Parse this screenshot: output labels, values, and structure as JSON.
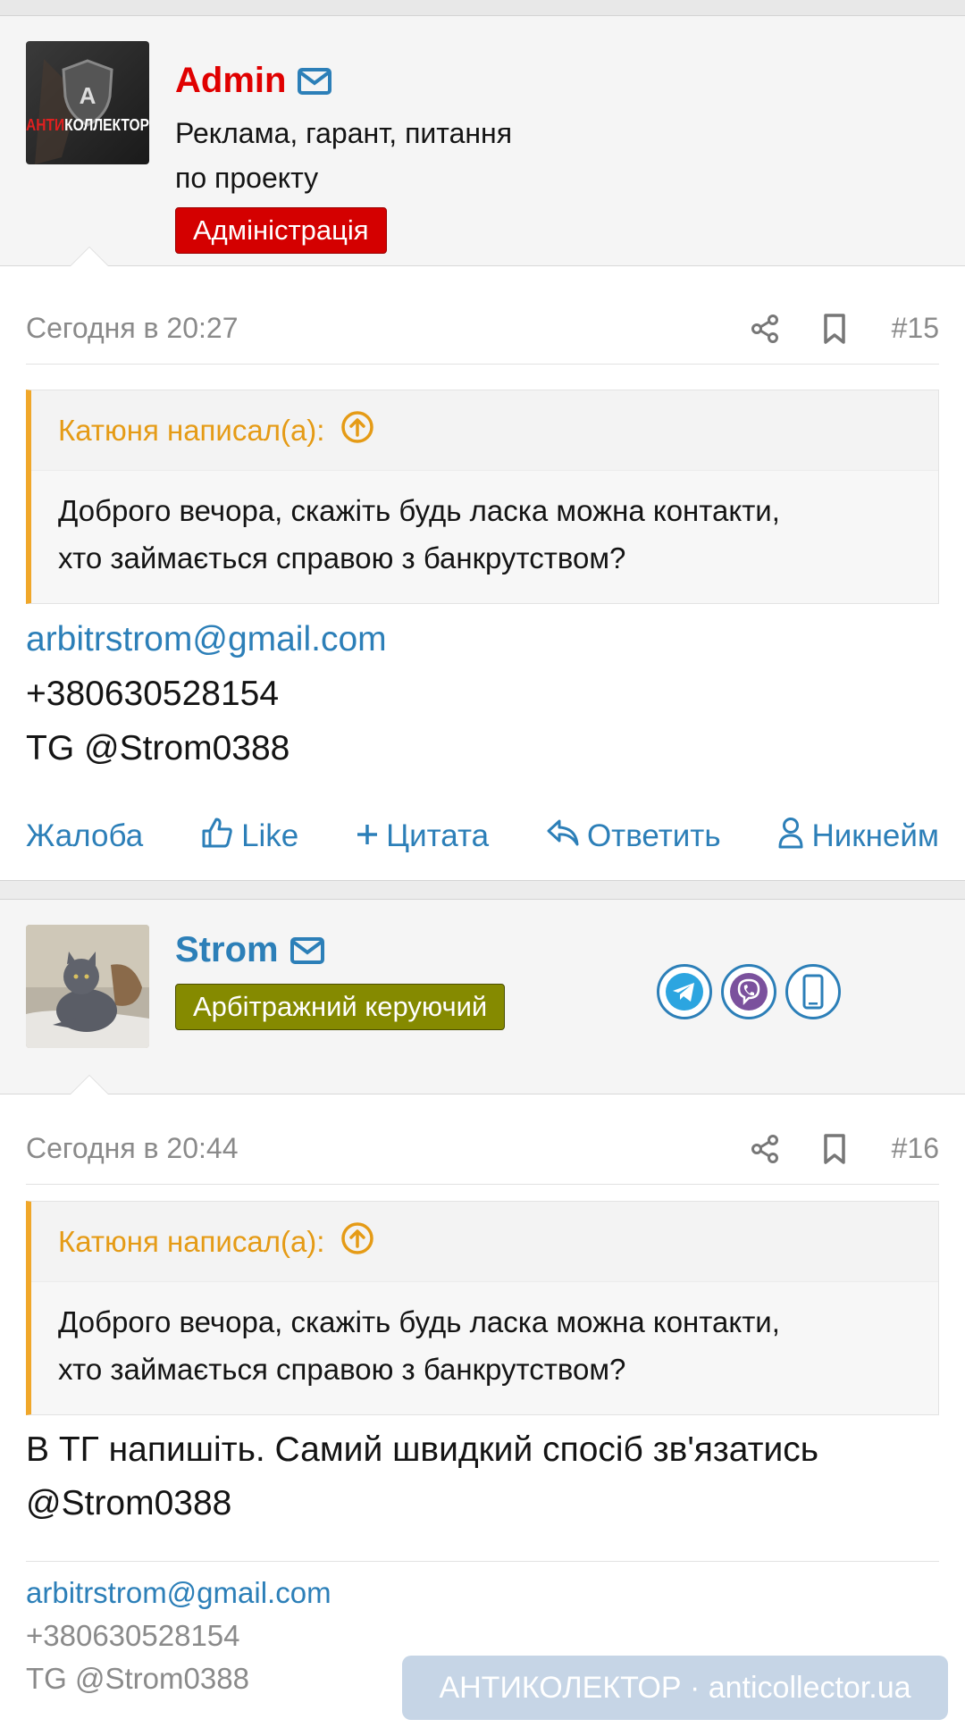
{
  "posts": [
    {
      "username": "Admin",
      "user_title_line1": "Реклама, гарант, питання",
      "user_title_line2": "по проекту",
      "badge": "Адміністрація",
      "avatar_text": "АНТИКОЛЛЕКТОР",
      "avatar_text_red": "АНТИ",
      "avatar_text_white": "КОЛЛЕКТОР",
      "avatar_letter": "A",
      "date": "Сегодня в 20:27",
      "post_number": "#15",
      "quote_author": "Катюня написал(а):",
      "quote_line1": "Доброго вечора, скажіть будь ласка можна контакти,",
      "quote_line2": "хто займається справою з банкрутством?",
      "content": {
        "email": "arbitrstrom@gmail.com",
        "phone": "+380630528154",
        "tg": "TG @Strom0388"
      },
      "actions": {
        "report": "Жалоба",
        "like": "Like",
        "quote": "Цитата",
        "reply": "Ответить",
        "nickname": "Никнейм"
      },
      "colors": {
        "username": "#e00000",
        "badge_bg": "#d40000"
      }
    },
    {
      "username": "Strom",
      "badge": "Арбітражний керуючий",
      "date": "Сегодня в 20:44",
      "post_number": "#16",
      "quote_author": "Катюня написал(а):",
      "quote_line1": "Доброго вечора, скажіть будь ласка можна контакти,",
      "quote_line2": "хто займається справою з банкрутством?",
      "content": {
        "line1": "В ТГ напишіть. Самий швидкий спосіб зв'язатись",
        "line2": "@Strom0388"
      },
      "signature": {
        "email": "arbitrstrom@gmail.com",
        "phone": "+380630528154",
        "tg": "TG @Strom0388"
      },
      "contact_icons": [
        "telegram-icon",
        "viber-icon",
        "phone-icon"
      ],
      "colors": {
        "username": "#2c7fb8",
        "badge_bg": "#858a00",
        "telegram": "#2ca5e0",
        "viber": "#7b519d",
        "phone": "#2c7fb8"
      }
    }
  ],
  "watermark": "АНТИКОЛЕКТОР · anticollector.ua"
}
